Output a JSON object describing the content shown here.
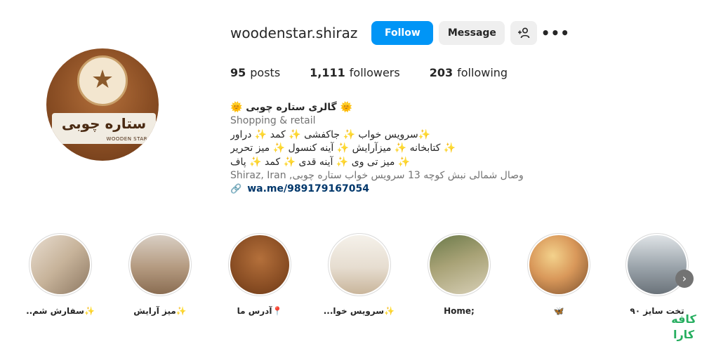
{
  "profile": {
    "username": "woodenstar.shiraz",
    "avatar_icon": "store-logo",
    "avatar_logo_text": "ستاره چوبی",
    "avatar_badge_text": "WOODEN STAR"
  },
  "actions": {
    "follow_label": "Follow",
    "message_label": "Message",
    "add_user_icon": "person-add-icon",
    "more_icon": "more-horizontal-icon"
  },
  "stats": [
    {
      "count": "95",
      "label": "posts"
    },
    {
      "count": "1,111",
      "label": "followers"
    },
    {
      "count": "203",
      "label": "following"
    }
  ],
  "bio": {
    "name": "🌞 گالری ستاره چوبی 🌞",
    "category": "Shopping & retail",
    "lines": [
      "✨سرویس خواب ✨ جاکفشی ✨ کمد ✨ دراور",
      "✨ کتابخانه ✨ میزآرایش ✨ آینه کنسول ✨ میز تحریر",
      "✨ میز تی وی ✨ آینه قدی ✨ کمد ✨ پاف"
    ],
    "address": "Shiraz, Iran ,وصال شمالی نبش کوچه 13 سرویس خواب ستاره چوبی",
    "link": "wa.me/989179167054",
    "link_icon": "link-icon"
  },
  "highlights": [
    {
      "label": "✨سفارش شم..",
      "icon": "book-photo"
    },
    {
      "label": "✨میز آرایش",
      "icon": "vanity-photo"
    },
    {
      "label": "📍آدرس ما",
      "icon": "store-logo"
    },
    {
      "label": "✨سرویس خوا...",
      "icon": "bedroom-photo"
    },
    {
      "label": "Home;",
      "icon": "living-room-photo"
    },
    {
      "label": "🦋",
      "icon": "sunset-photo"
    },
    {
      "label": "تخت سایز ۹۰",
      "icon": "bed-photo"
    }
  ],
  "carousel": {
    "next_icon": "chevron-right-icon"
  },
  "watermark": {
    "line1": "کافه",
    "line2": "کارا"
  }
}
